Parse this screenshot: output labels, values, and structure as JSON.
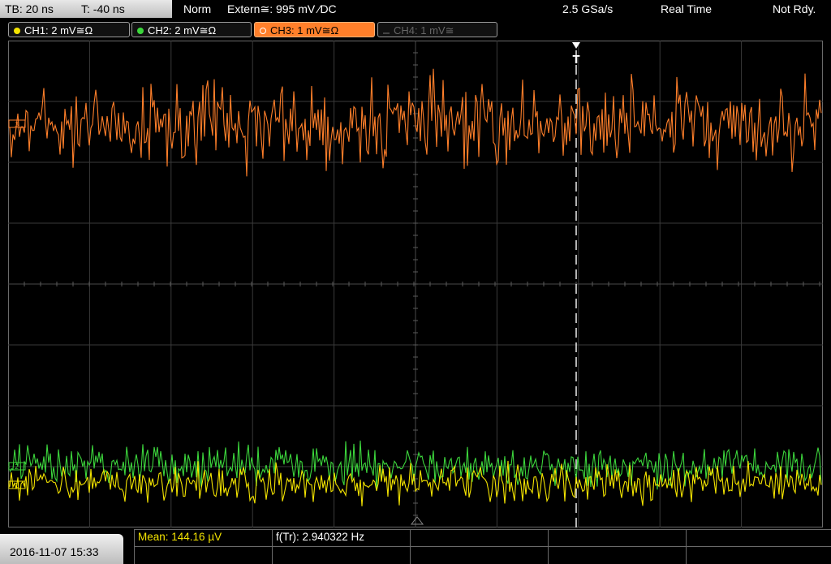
{
  "timebase": {
    "tb": "TB: 20 ns",
    "t": "T: -40 ns"
  },
  "trigger": {
    "mode": "Norm",
    "source": "Extern≅: 995 mV ⁄DC"
  },
  "acquisition": {
    "rate": "2.5 GSa/s",
    "mode": "Real Time",
    "state": "Not Rdy."
  },
  "channels": [
    {
      "label": "CH1: 2 mV≅Ω",
      "color": "#f4e400"
    },
    {
      "label": "CH2: 2 mV≅Ω",
      "color": "#3cd63c"
    },
    {
      "label": "CH3: 1 mV≅Ω",
      "color": "#ff7f2a"
    },
    {
      "label": "CH4: 1 mV≅",
      "color": "#666666"
    }
  ],
  "markers": {
    "trigger": "T",
    "ch3": "3",
    "ch2": "2",
    "ch1": "1"
  },
  "measurements": {
    "mean": "Mean: 144.16 µV",
    "freq": "f(Tr): 2.940322 Hz"
  },
  "datetime": "2016-11-07 15:33"
}
